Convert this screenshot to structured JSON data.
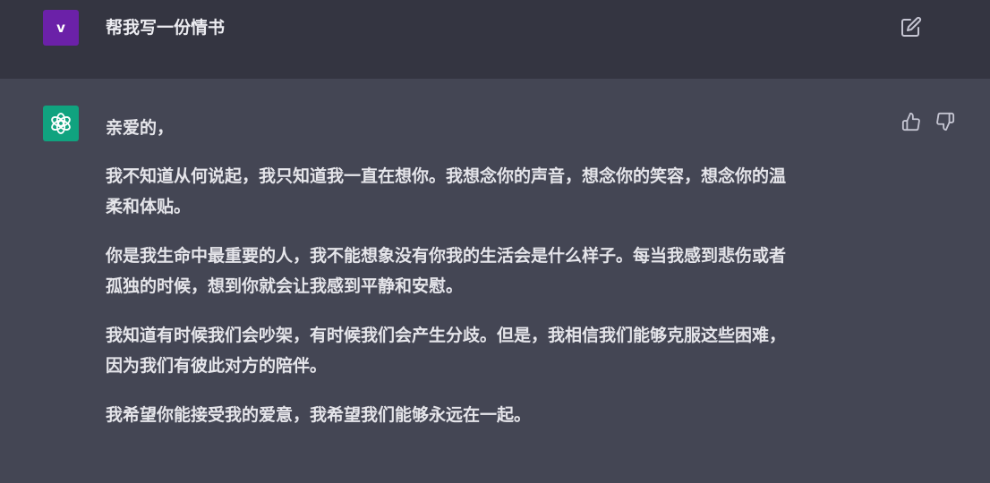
{
  "user": {
    "avatar_letter": "v",
    "message": "帮我写一份情书",
    "avatar_color": "#6b21a8"
  },
  "assistant": {
    "avatar_color": "#10a37f",
    "greeting": "亲爱的，",
    "paragraphs": [
      [
        "我不知道从何说起，我只知道我一直在想你。我想念你的声音，想念你的笑容，想念你的温",
        "柔和体贴。"
      ],
      [
        "你是我生命中最重要的人，我不能想象没有你我的生活会是什么样子。每当我感到悲伤或者",
        "孤独的时候，想到你就会让我感到平静和安慰。"
      ],
      [
        "我知道有时候我们会吵架，有时候我们会产生分歧。但是，我相信我们能够克服这些困难，",
        "因为我们有彼此对方的陪伴。"
      ],
      [
        "我希望你能接受我的爱意，我希望我们能够永远在一起。"
      ]
    ]
  },
  "icons": {
    "edit": "edit-icon",
    "thumbs_up": "thumbs-up-icon",
    "thumbs_down": "thumbs-down-icon",
    "bot_logo": "openai-logo-icon"
  }
}
